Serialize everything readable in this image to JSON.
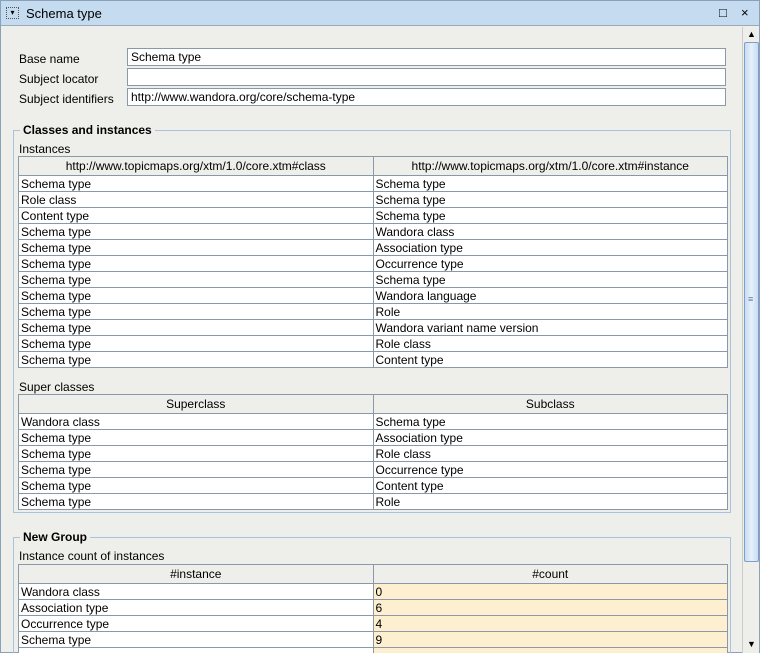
{
  "window": {
    "title": "Schema type",
    "maximize_icon": "□",
    "close_icon": "×"
  },
  "fields": {
    "base_name_label": "Base name",
    "base_name_value": "Schema type",
    "subject_locator_label": "Subject locator",
    "subject_locator_value": "",
    "subject_identifiers_label": "Subject identifiers",
    "subject_identifiers_value": "http://www.wandora.org/core/schema-type"
  },
  "classes_group": {
    "title": "Classes and instances",
    "instances": {
      "label": "Instances",
      "headers": [
        "http://www.topicmaps.org/xtm/1.0/core.xtm#class",
        "http://www.topicmaps.org/xtm/1.0/core.xtm#instance"
      ],
      "rows": [
        [
          "Schema type",
          "Schema type"
        ],
        [
          "Role class",
          "Schema type"
        ],
        [
          "Content type",
          "Schema type"
        ],
        [
          "Schema type",
          "Wandora class"
        ],
        [
          "Schema type",
          "Association type"
        ],
        [
          "Schema type",
          "Occurrence type"
        ],
        [
          "Schema type",
          "Schema type"
        ],
        [
          "Schema type",
          "Wandora language"
        ],
        [
          "Schema type",
          "Role"
        ],
        [
          "Schema type",
          "Wandora variant name version"
        ],
        [
          "Schema type",
          "Role class"
        ],
        [
          "Schema type",
          "Content type"
        ]
      ]
    },
    "superclasses": {
      "label": "Super classes",
      "headers": [
        "Superclass",
        "Subclass"
      ],
      "rows": [
        [
          "Wandora class",
          "Schema type"
        ],
        [
          "Schema type",
          "Association type"
        ],
        [
          "Schema type",
          "Role class"
        ],
        [
          "Schema type",
          "Occurrence type"
        ],
        [
          "Schema type",
          "Content type"
        ],
        [
          "Schema type",
          "Role"
        ]
      ]
    }
  },
  "new_group": {
    "title": "New Group",
    "label": "Instance count of instances",
    "headers": [
      "#instance",
      "#count"
    ],
    "rows": [
      [
        "Wandora class",
        "0"
      ],
      [
        "Association type",
        "6"
      ],
      [
        "Occurrence type",
        "4"
      ],
      [
        "Schema type",
        "9"
      ]
    ]
  }
}
